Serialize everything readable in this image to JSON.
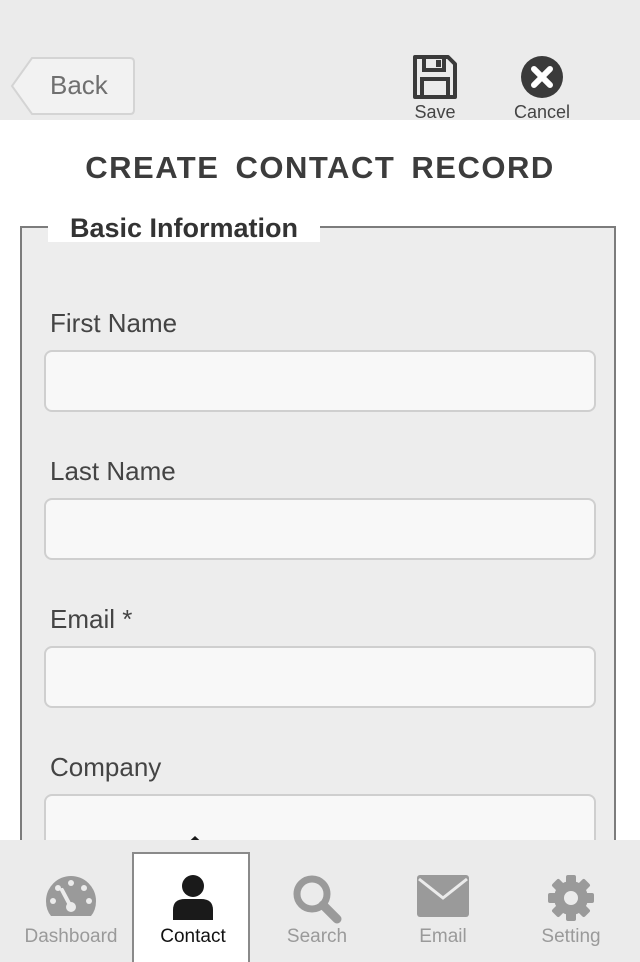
{
  "header": {
    "back_label": "Back",
    "save_label": "Save",
    "cancel_label": "Cancel"
  },
  "page_title": "CREATE CONTACT RECORD",
  "section": {
    "legend": "Basic Information",
    "fields": [
      {
        "label": "First Name",
        "value": ""
      },
      {
        "label": "Last Name",
        "value": ""
      },
      {
        "label": "Email *",
        "value": ""
      },
      {
        "label": "Company",
        "value": ""
      }
    ]
  },
  "tabs": [
    {
      "label": "Dashboard",
      "icon": "dashboard-gauge-icon",
      "active": false
    },
    {
      "label": "Contact",
      "icon": "person-icon",
      "active": true
    },
    {
      "label": "Search",
      "icon": "magnifier-icon",
      "active": false
    },
    {
      "label": "Email",
      "icon": "envelope-icon",
      "active": false
    },
    {
      "label": "Setting",
      "icon": "gear-icon",
      "active": false
    }
  ],
  "colors": {
    "background": "#ececec",
    "panel": "#ffffff",
    "icon_dark": "#3a3a3a",
    "icon_inactive": "#9a9a9a"
  }
}
